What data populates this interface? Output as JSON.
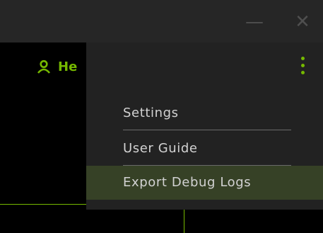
{
  "titlebar": {
    "minimize_symbol": "—",
    "close_symbol": "✕"
  },
  "user": {
    "name_fragment": "He",
    "icon": "user-icon"
  },
  "menu": {
    "icon": "kebab-menu-icon",
    "items": [
      {
        "label": "Settings"
      },
      {
        "label": "User Guide"
      },
      {
        "label": "Export Debug Logs",
        "highlighted": true
      }
    ]
  },
  "colors": {
    "accent": "#76b900",
    "titlebar_bg": "#262626",
    "menu_bg": "#222222",
    "highlight_bg": "#364126",
    "menu_text": "#d2d2d2"
  }
}
